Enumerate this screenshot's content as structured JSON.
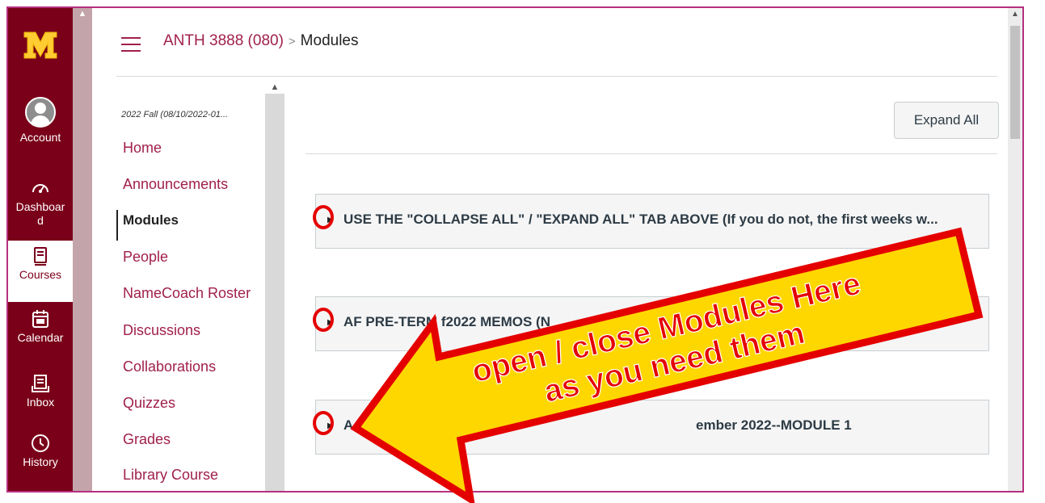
{
  "global_nav": {
    "items": [
      {
        "label": "Account",
        "icon": "account-avatar-icon"
      },
      {
        "label": "Dashboar\nd",
        "label_line1": "Dashboar",
        "label_line2": "d",
        "icon": "dashboard-icon"
      },
      {
        "label": "Courses",
        "icon": "courses-icon",
        "active": true
      },
      {
        "label": "Calendar",
        "icon": "calendar-icon"
      },
      {
        "label": "Inbox",
        "icon": "inbox-icon"
      },
      {
        "label": "History",
        "icon": "history-icon"
      }
    ],
    "brand_color": "#7a0019",
    "logo_color": "#ffcc33"
  },
  "header": {
    "course": "ANTH 3888 (080)",
    "separator": ">",
    "current": "Modules"
  },
  "course_nav": {
    "term": "2022 Fall (08/10/2022-01...",
    "items": [
      {
        "label": "Home"
      },
      {
        "label": "Announcements"
      },
      {
        "label": "Modules",
        "active": true
      },
      {
        "label": "People"
      },
      {
        "label": "NameCoach Roster"
      },
      {
        "label": "Discussions"
      },
      {
        "label": "Collaborations"
      },
      {
        "label": "Quizzes"
      },
      {
        "label": "Grades"
      },
      {
        "label": "Library Course"
      }
    ]
  },
  "main": {
    "expand_all_label": "Expand All",
    "modules": [
      {
        "title": "USE THE \"COLLAPSE ALL\" / \"EXPAND ALL\" TAB ABOVE (If you do not, the first weeks w..."
      },
      {
        "title": "AF PRE-TERM f2022 MEMOS (N"
      },
      {
        "title": "A",
        "title_tail": "ember 2022--MODULE 1"
      }
    ]
  },
  "annotation": {
    "line1": "open / close Modules Here",
    "line2": "as you need them",
    "arrow_color": "#ffd700",
    "outline_color": "#e50000"
  }
}
